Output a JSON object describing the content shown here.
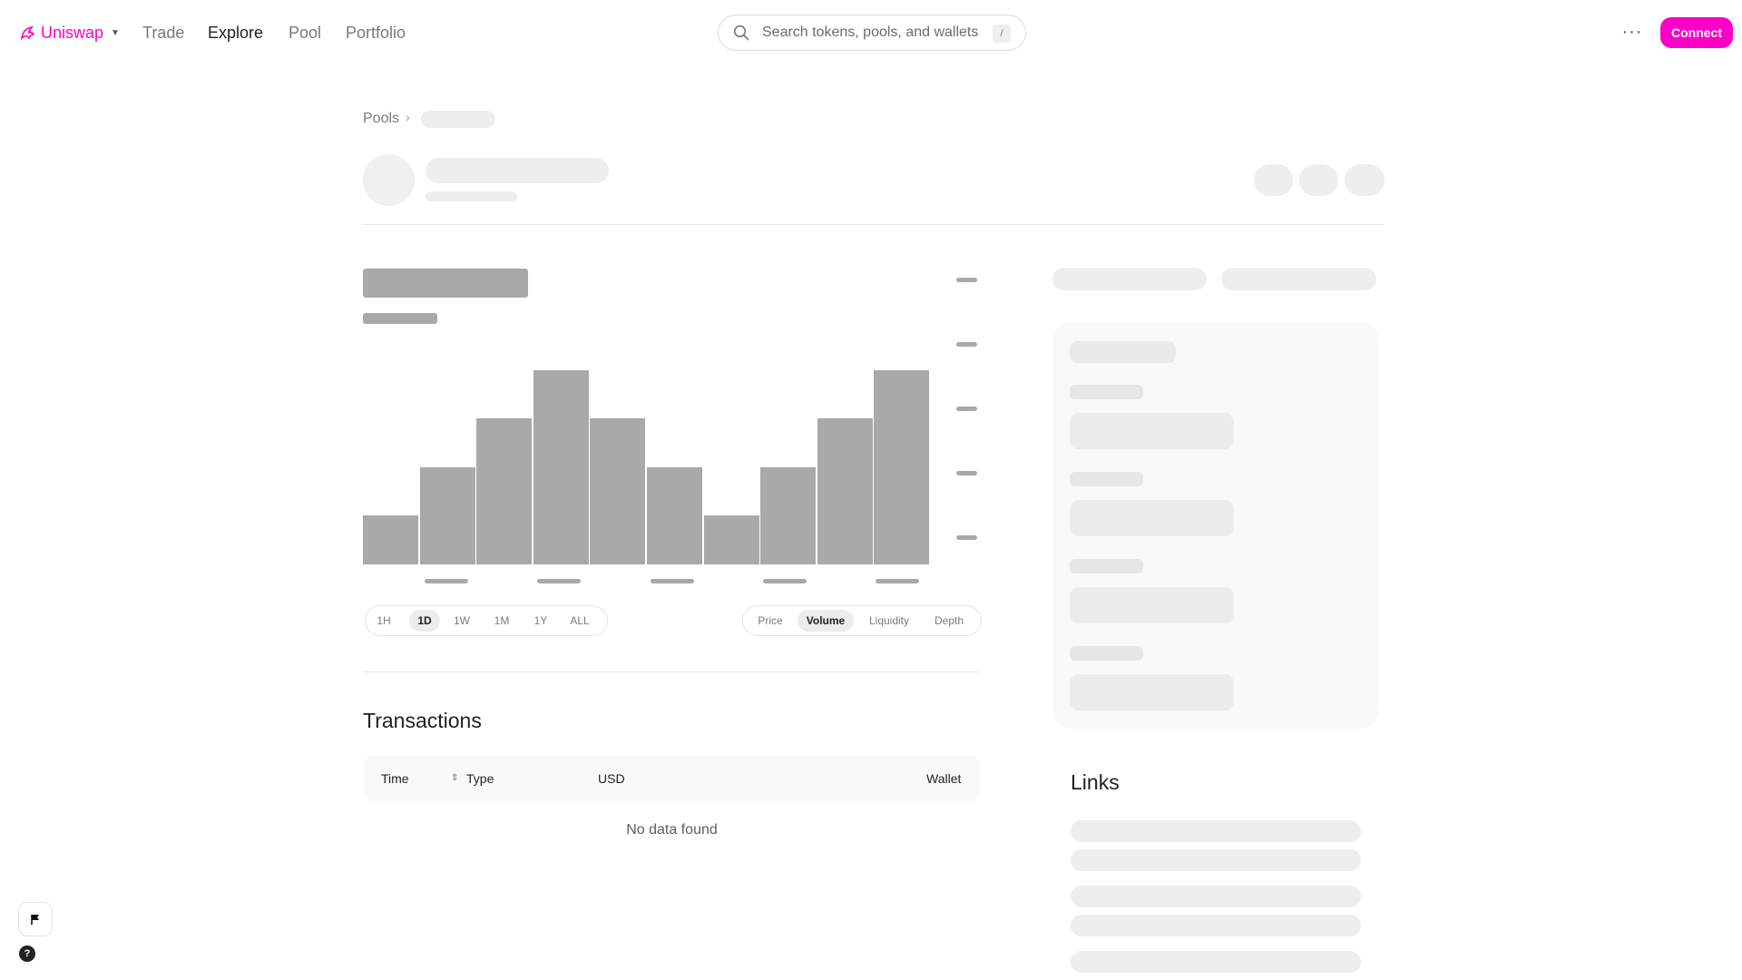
{
  "nav": {
    "brand": "Uniswap",
    "links": [
      "Trade",
      "Explore",
      "Pool",
      "Portfolio"
    ],
    "active": "Explore",
    "search_placeholder": "Search tokens, pools, and wallets",
    "search_shortcut": "/",
    "connect_label": "Connect"
  },
  "breadcrumb": {
    "root": "Pools"
  },
  "chart": {
    "time_ranges": [
      "1H",
      "1D",
      "1W",
      "1M",
      "1Y",
      "ALL"
    ],
    "selected_range": "1D",
    "chart_types": [
      "Price",
      "Volume",
      "Liquidity",
      "Depth"
    ],
    "selected_type": "Volume",
    "placeholder_bar_levels": [
      1,
      2,
      3,
      4,
      3,
      2,
      1,
      2,
      3,
      4
    ],
    "placeholder_bar_max_level": 4
  },
  "transactions": {
    "title": "Transactions",
    "columns": [
      "Time",
      "Type",
      "USD",
      "Wallet"
    ],
    "empty_text": "No data found"
  },
  "links": {
    "title": "Links"
  },
  "colors": {
    "accent": "#fc00c8",
    "skeleton": "#eeeeee",
    "skeleton_dark": "#a9a9a9"
  },
  "icons": [
    "uniswap-logo-icon",
    "search-icon",
    "more-icon",
    "chevron-right-icon",
    "sort-icon",
    "flag-icon",
    "help-icon"
  ]
}
